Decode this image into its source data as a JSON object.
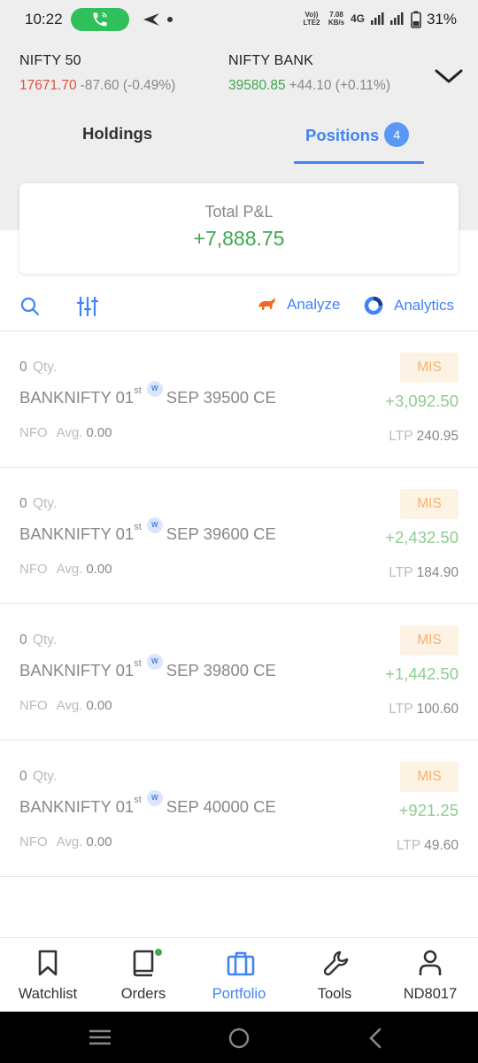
{
  "status_bar": {
    "time": "10:22",
    "volte_line1": "Vo))",
    "volte_line2": "LTE2",
    "speed_value": "7.08",
    "speed_unit": "KB/s",
    "network": "4G",
    "battery": "31%"
  },
  "indices": [
    {
      "name": "NIFTY 50",
      "value": "17671.70",
      "change": "-87.60 (-0.49%)",
      "trend": "down"
    },
    {
      "name": "NIFTY BANK",
      "value": "39580.85",
      "change": "+44.10 (+0.11%)",
      "trend": "up"
    }
  ],
  "tabs": {
    "holdings": "Holdings",
    "positions": "Positions",
    "positions_count": "4",
    "active": "positions"
  },
  "total_pnl": {
    "label": "Total P&L",
    "value": "+7,888.75"
  },
  "toolbar": {
    "analyze": "Analyze",
    "analytics": "Analytics"
  },
  "positions": [
    {
      "qty": "0",
      "qty_unit": "Qty.",
      "symbol": "BANKNIFTY 01",
      "suffix": "st",
      "weekly": "W",
      "contract": "SEP 39500 CE",
      "exchange": "NFO",
      "avg_label": "Avg.",
      "avg": "0.00",
      "product": "MIS",
      "pnl": "+3,092.50",
      "ltp_label": "LTP",
      "ltp": "240.95"
    },
    {
      "qty": "0",
      "qty_unit": "Qty.",
      "symbol": "BANKNIFTY 01",
      "suffix": "st",
      "weekly": "W",
      "contract": "SEP 39600 CE",
      "exchange": "NFO",
      "avg_label": "Avg.",
      "avg": "0.00",
      "product": "MIS",
      "pnl": "+2,432.50",
      "ltp_label": "LTP",
      "ltp": "184.90"
    },
    {
      "qty": "0",
      "qty_unit": "Qty.",
      "symbol": "BANKNIFTY 01",
      "suffix": "st",
      "weekly": "W",
      "contract": "SEP 39800 CE",
      "exchange": "NFO",
      "avg_label": "Avg.",
      "avg": "0.00",
      "product": "MIS",
      "pnl": "+1,442.50",
      "ltp_label": "LTP",
      "ltp": "100.60"
    },
    {
      "qty": "0",
      "qty_unit": "Qty.",
      "symbol": "BANKNIFTY 01",
      "suffix": "st",
      "weekly": "W",
      "contract": "SEP 40000 CE",
      "exchange": "NFO",
      "avg_label": "Avg.",
      "avg": "0.00",
      "product": "MIS",
      "pnl": "+921.25",
      "ltp_label": "LTP",
      "ltp": "49.60"
    }
  ],
  "bottom_nav": [
    {
      "label": "Watchlist",
      "icon": "bookmark-icon"
    },
    {
      "label": "Orders",
      "icon": "book-icon"
    },
    {
      "label": "Portfolio",
      "icon": "briefcase-icon",
      "active": true
    },
    {
      "label": "Tools",
      "icon": "wrench-icon"
    },
    {
      "label": "ND8017",
      "icon": "user-icon"
    }
  ],
  "colors": {
    "accent": "#4184f3",
    "profit": "#3ea74f",
    "loss": "#e0533d",
    "badge_bg": "#fdf3e4",
    "badge_text": "#f4b26b"
  }
}
